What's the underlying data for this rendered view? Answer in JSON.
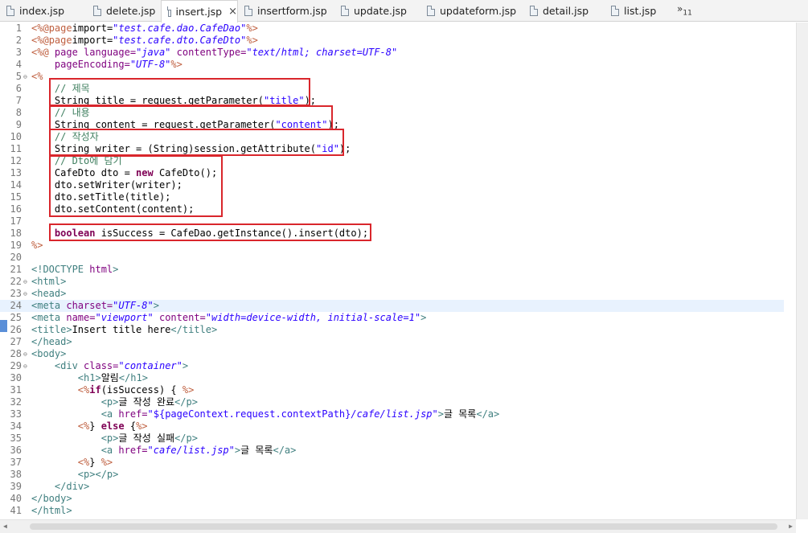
{
  "tabs": [
    {
      "label": "index.jsp",
      "icon": "jsp-file-icon"
    },
    {
      "label": "delete.jsp",
      "icon": "jsp-file-icon"
    },
    {
      "label": "insert.jsp",
      "icon": "jsp-file-icon",
      "active": true,
      "close": "×"
    },
    {
      "label": "insertform.jsp",
      "icon": "jsp-file-icon"
    },
    {
      "label": "update.jsp",
      "icon": "jsp-file-icon"
    },
    {
      "label": "updateform.jsp",
      "icon": "jsp-file-icon"
    },
    {
      "label": "detail.jsp",
      "icon": "jsp-file-icon"
    },
    {
      "label": "list.jsp",
      "icon": "jsp-file-icon"
    }
  ],
  "overflow": {
    "chevron": "»",
    "count": "11"
  },
  "editor": {
    "current_line": 24,
    "fold_marker": "⊖",
    "highlight_color": "#d9262c",
    "lines": [
      {
        "n": "1",
        "tokens": [
          [
            "jsp",
            "<%@"
          ],
          [
            "jsp",
            "page"
          ],
          [
            "",
            "import="
          ],
          [
            "stri",
            "\"test.cafe.dao.CafeDao\""
          ],
          [
            "jsp",
            "%>"
          ]
        ]
      },
      {
        "n": "2",
        "tokens": [
          [
            "jsp",
            "<%@"
          ],
          [
            "jsp",
            "page"
          ],
          [
            "",
            "import="
          ],
          [
            "stri",
            "\"test.cafe.dto.CafeDto\""
          ],
          [
            "jsp",
            "%>"
          ]
        ]
      },
      {
        "n": "3",
        "tokens": [
          [
            "jsp",
            "<%@ "
          ],
          [
            "attr",
            "page "
          ],
          [
            "attr",
            "language="
          ],
          [
            "stri",
            "\"java\" "
          ],
          [
            "attr",
            "contentType="
          ],
          [
            "stri",
            "\"text/html; charset=UTF-8\""
          ]
        ]
      },
      {
        "n": "4",
        "tokens": [
          [
            "",
            "    "
          ],
          [
            "attr",
            "pageEncoding="
          ],
          [
            "stri",
            "\"UTF-8\""
          ],
          [
            "jsp",
            "%>"
          ]
        ]
      },
      {
        "n": "5",
        "fold": true,
        "tokens": [
          [
            "jsp",
            "<%"
          ]
        ]
      },
      {
        "n": "6",
        "tokens": [
          [
            "cmt",
            "    // 제목"
          ]
        ]
      },
      {
        "n": "7",
        "tokens": [
          [
            "",
            "    String title = request.getParameter("
          ],
          [
            "str",
            "\"title\""
          ],
          [
            "",
            ");"
          ]
        ]
      },
      {
        "n": "8",
        "tokens": [
          [
            "cmt",
            "    // 내용"
          ]
        ]
      },
      {
        "n": "9",
        "tokens": [
          [
            "",
            "    String content = request.getParameter("
          ],
          [
            "str",
            "\"content\""
          ],
          [
            "",
            ");"
          ]
        ]
      },
      {
        "n": "10",
        "tokens": [
          [
            "cmt",
            "    // 작성자"
          ]
        ]
      },
      {
        "n": "11",
        "tokens": [
          [
            "",
            "    String writer = (String)session.getAttribute("
          ],
          [
            "str",
            "\"id\""
          ],
          [
            "",
            ");"
          ]
        ]
      },
      {
        "n": "12",
        "tokens": [
          [
            "cmt",
            "    // Dto에 담기"
          ]
        ]
      },
      {
        "n": "13",
        "tokens": [
          [
            "",
            "    CafeDto dto = "
          ],
          [
            "kw",
            "new"
          ],
          [
            "",
            " CafeDto();"
          ]
        ]
      },
      {
        "n": "14",
        "tokens": [
          [
            "",
            "    dto.setWriter(writer);"
          ]
        ]
      },
      {
        "n": "15",
        "tokens": [
          [
            "",
            "    dto.setTitle(title);"
          ]
        ]
      },
      {
        "n": "16",
        "tokens": [
          [
            "",
            "    dto.setContent(content);"
          ]
        ]
      },
      {
        "n": "17",
        "tokens": []
      },
      {
        "n": "18",
        "tokens": [
          [
            "",
            "    "
          ],
          [
            "kw",
            "boolean"
          ],
          [
            "",
            " isSuccess = CafeDao.getInstance().insert(dto);"
          ]
        ]
      },
      {
        "n": "19",
        "tokens": [
          [
            "jsp",
            "%>"
          ]
        ]
      },
      {
        "n": "20",
        "tokens": []
      },
      {
        "n": "21",
        "tokens": [
          [
            "tag",
            "<!DOCTYPE "
          ],
          [
            "attr",
            "html"
          ],
          [
            "tag",
            ">"
          ]
        ]
      },
      {
        "n": "22",
        "fold": true,
        "tokens": [
          [
            "tag",
            "<html>"
          ]
        ]
      },
      {
        "n": "23",
        "fold": true,
        "tokens": [
          [
            "tag",
            "<head>"
          ]
        ]
      },
      {
        "n": "24",
        "tokens": [
          [
            "tag",
            "<meta "
          ],
          [
            "attr",
            "charset="
          ],
          [
            "stri",
            "\"UTF-8\""
          ],
          [
            "tag",
            ">"
          ]
        ]
      },
      {
        "n": "25",
        "tokens": [
          [
            "tag",
            "<meta "
          ],
          [
            "attr",
            "name="
          ],
          [
            "stri",
            "\"viewport\" "
          ],
          [
            "attr",
            "content="
          ],
          [
            "stri",
            "\"width=device-width, initial-scale=1\""
          ],
          [
            "tag",
            ">"
          ]
        ]
      },
      {
        "n": "26",
        "tokens": [
          [
            "tag",
            "<title>"
          ],
          [
            "",
            "Insert title here"
          ],
          [
            "tag",
            "</title>"
          ]
        ]
      },
      {
        "n": "27",
        "tokens": [
          [
            "tag",
            "</head>"
          ]
        ]
      },
      {
        "n": "28",
        "fold": true,
        "tokens": [
          [
            "tag",
            "<body>"
          ]
        ]
      },
      {
        "n": "29",
        "fold": true,
        "tokens": [
          [
            "",
            "    "
          ],
          [
            "tag",
            "<div "
          ],
          [
            "attr",
            "class="
          ],
          [
            "stri",
            "\"container\""
          ],
          [
            "tag",
            ">"
          ]
        ]
      },
      {
        "n": "30",
        "tokens": [
          [
            "",
            "        "
          ],
          [
            "tag",
            "<h1>"
          ],
          [
            "",
            "알림"
          ],
          [
            "tag",
            "</h1>"
          ]
        ]
      },
      {
        "n": "31",
        "tokens": [
          [
            "",
            "        "
          ],
          [
            "jsp",
            "<%"
          ],
          [
            "kw",
            "if"
          ],
          [
            "",
            "(isSuccess) { "
          ],
          [
            "jsp",
            "%>"
          ]
        ]
      },
      {
        "n": "32",
        "tokens": [
          [
            "",
            "            "
          ],
          [
            "tag",
            "<p>"
          ],
          [
            "",
            "글 작성 완료"
          ],
          [
            "tag",
            "</p>"
          ]
        ]
      },
      {
        "n": "33",
        "tokens": [
          [
            "",
            "            "
          ],
          [
            "tag",
            "<a "
          ],
          [
            "attr",
            "href="
          ],
          [
            "str",
            "\"${pageContext.request.contextPath}"
          ],
          [
            "stri",
            "/cafe/list.jsp\""
          ],
          [
            "tag",
            ">"
          ],
          [
            "",
            "글 목록"
          ],
          [
            "tag",
            "</a>"
          ]
        ]
      },
      {
        "n": "34",
        "tokens": [
          [
            "",
            "        "
          ],
          [
            "jsp",
            "<%"
          ],
          [
            "",
            "} "
          ],
          [
            "kw",
            "else"
          ],
          [
            "",
            " {"
          ],
          [
            "jsp",
            "%>"
          ]
        ]
      },
      {
        "n": "35",
        "tokens": [
          [
            "",
            "            "
          ],
          [
            "tag",
            "<p>"
          ],
          [
            "",
            "글 작성 실패"
          ],
          [
            "tag",
            "</p>"
          ]
        ]
      },
      {
        "n": "36",
        "tokens": [
          [
            "",
            "            "
          ],
          [
            "tag",
            "<a "
          ],
          [
            "attr",
            "href="
          ],
          [
            "stri",
            "\"cafe/list.jsp\""
          ],
          [
            "tag",
            ">"
          ],
          [
            "",
            "글 목록"
          ],
          [
            "tag",
            "</a>"
          ]
        ]
      },
      {
        "n": "37",
        "tokens": [
          [
            "",
            "        "
          ],
          [
            "jsp",
            "<%"
          ],
          [
            "",
            "} "
          ],
          [
            "jsp",
            "%>"
          ]
        ]
      },
      {
        "n": "38",
        "tokens": [
          [
            "",
            "        "
          ],
          [
            "tag",
            "<p></p>"
          ]
        ]
      },
      {
        "n": "39",
        "tokens": [
          [
            "",
            "    "
          ],
          [
            "tag",
            "</div>"
          ]
        ]
      },
      {
        "n": "40",
        "tokens": [
          [
            "tag",
            "</body>"
          ]
        ]
      },
      {
        "n": "41",
        "tokens": [
          [
            "tag",
            "</html>"
          ]
        ]
      }
    ]
  },
  "scrollbar": {
    "left_arrow": "◀",
    "right_arrow": "▶"
  }
}
